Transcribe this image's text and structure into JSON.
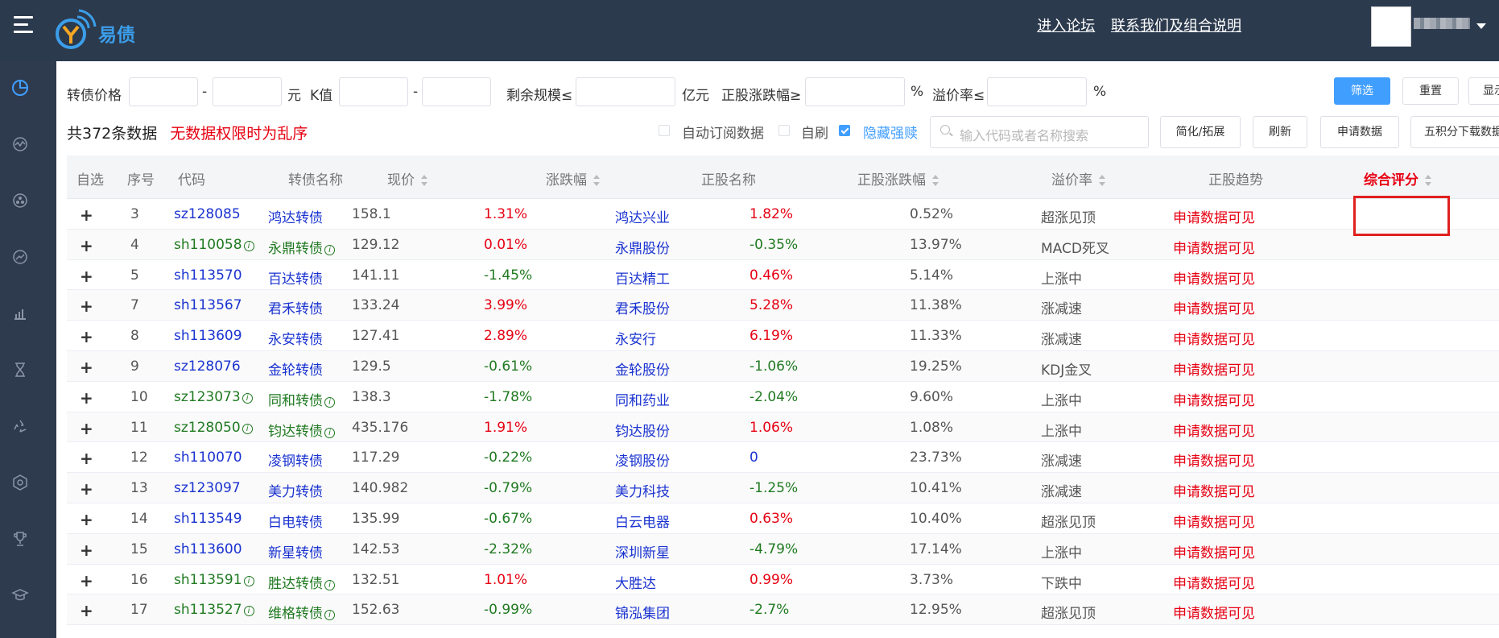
{
  "header": {
    "logo_text": "易债",
    "links": [
      "进入论坛",
      "联系我们及组合说明"
    ]
  },
  "filters": {
    "price_label": "转债价格",
    "dash": "-",
    "yuan": "元",
    "k_label": "K值",
    "scale_label": "剩余规模≤",
    "yiyuan": "亿元",
    "stock_change_label": "正股涨跌幅≥",
    "pct": "%",
    "premium_label": "溢价率≤",
    "btn_filter": "筛选",
    "btn_reset": "重置",
    "btn_display": "显示"
  },
  "summary": {
    "count_text": "共372条数据",
    "warning": "无数据权限时为乱序"
  },
  "options": {
    "auto_sub": "自动订阅数据",
    "self_refresh": "自刷",
    "hide_forced": "隐藏强赎",
    "search_placeholder": "输入代码或者名称搜索",
    "btn_simplify": "简化/拓展",
    "btn_refresh": "刷新",
    "btn_apply": "申请数据",
    "btn_download": "五积分下载数据"
  },
  "table": {
    "headers": [
      "自选",
      "序号",
      "代码",
      "转债名称",
      "现价",
      "涨跌幅",
      "正股名称",
      "正股涨跌幅",
      "溢价率",
      "正股趋势",
      "综合评分"
    ],
    "rows": [
      {
        "no": "3",
        "code": "sz128085",
        "name": "鸿达转债",
        "price": "158.1",
        "chg": "1.31%",
        "stock": "鸿达兴业",
        "schg": "1.82%",
        "premium": "0.52%",
        "trend": "超涨见顶",
        "score": "申请数据可见",
        "flag": false,
        "chg_up": true,
        "schg_up": true
      },
      {
        "no": "4",
        "code": "sh110058",
        "name": "永鼎转债",
        "price": "129.12",
        "chg": "0.01%",
        "stock": "永鼎股份",
        "schg": "-0.35%",
        "premium": "13.97%",
        "trend": "MACD死叉",
        "score": "申请数据可见",
        "flag": true,
        "chg_up": true,
        "schg_up": false
      },
      {
        "no": "5",
        "code": "sh113570",
        "name": "百达转债",
        "price": "141.11",
        "chg": "-1.45%",
        "stock": "百达精工",
        "schg": "0.46%",
        "premium": "5.14%",
        "trend": "上涨中",
        "score": "申请数据可见",
        "flag": false,
        "chg_up": false,
        "schg_up": true
      },
      {
        "no": "7",
        "code": "sh113567",
        "name": "君禾转债",
        "price": "133.24",
        "chg": "3.99%",
        "stock": "君禾股份",
        "schg": "5.28%",
        "premium": "11.38%",
        "trend": "涨减速",
        "score": "申请数据可见",
        "flag": false,
        "chg_up": true,
        "schg_up": true
      },
      {
        "no": "8",
        "code": "sh113609",
        "name": "永安转债",
        "price": "127.41",
        "chg": "2.89%",
        "stock": "永安行",
        "schg": "6.19%",
        "premium": "11.33%",
        "trend": "涨减速",
        "score": "申请数据可见",
        "flag": false,
        "chg_up": true,
        "schg_up": true
      },
      {
        "no": "9",
        "code": "sz128076",
        "name": "金轮转债",
        "price": "129.5",
        "chg": "-0.61%",
        "stock": "金轮股份",
        "schg": "-1.06%",
        "premium": "19.25%",
        "trend": "KDJ金叉",
        "score": "申请数据可见",
        "flag": false,
        "chg_up": false,
        "schg_up": false
      },
      {
        "no": "10",
        "code": "sz123073",
        "name": "同和转债",
        "price": "138.3",
        "chg": "-1.78%",
        "stock": "同和药业",
        "schg": "-2.04%",
        "premium": "9.60%",
        "trend": "上涨中",
        "score": "申请数据可见",
        "flag": true,
        "chg_up": false,
        "schg_up": false
      },
      {
        "no": "11",
        "code": "sz128050",
        "name": "钧达转债",
        "price": "435.176",
        "chg": "1.91%",
        "stock": "钧达股份",
        "schg": "1.06%",
        "premium": "1.08%",
        "trend": "上涨中",
        "score": "申请数据可见",
        "flag": true,
        "chg_up": true,
        "schg_up": true
      },
      {
        "no": "12",
        "code": "sh110070",
        "name": "凌钢转债",
        "price": "117.29",
        "chg": "-0.22%",
        "stock": "凌钢股份",
        "schg": "0",
        "premium": "23.73%",
        "trend": "涨减速",
        "score": "申请数据可见",
        "flag": false,
        "chg_up": false,
        "schg_up": null
      },
      {
        "no": "13",
        "code": "sz123097",
        "name": "美力转债",
        "price": "140.982",
        "chg": "-0.79%",
        "stock": "美力科技",
        "schg": "-1.25%",
        "premium": "10.41%",
        "trend": "涨减速",
        "score": "申请数据可见",
        "flag": false,
        "chg_up": false,
        "schg_up": false
      },
      {
        "no": "14",
        "code": "sh113549",
        "name": "白电转债",
        "price": "135.99",
        "chg": "-0.67%",
        "stock": "白云电器",
        "schg": "0.63%",
        "premium": "10.40%",
        "trend": "超涨见顶",
        "score": "申请数据可见",
        "flag": false,
        "chg_up": false,
        "schg_up": true
      },
      {
        "no": "15",
        "code": "sh113600",
        "name": "新星转债",
        "price": "142.53",
        "chg": "-2.32%",
        "stock": "深圳新星",
        "schg": "-4.79%",
        "premium": "17.14%",
        "trend": "上涨中",
        "score": "申请数据可见",
        "flag": false,
        "chg_up": false,
        "schg_up": false
      },
      {
        "no": "16",
        "code": "sh113591",
        "name": "胜达转债",
        "price": "132.51",
        "chg": "1.01%",
        "stock": "大胜达",
        "schg": "0.99%",
        "premium": "3.73%",
        "trend": "下跌中",
        "score": "申请数据可见",
        "flag": true,
        "chg_up": true,
        "schg_up": true
      },
      {
        "no": "17",
        "code": "sh113527",
        "name": "维格转债",
        "price": "152.63",
        "chg": "-0.99%",
        "stock": "锦泓集团",
        "schg": "-2.7%",
        "premium": "12.95%",
        "trend": "超涨见顶",
        "score": "申请数据可见",
        "flag": true,
        "chg_up": false,
        "schg_up": false
      }
    ]
  },
  "colors": {
    "up": "#e60012",
    "down": "#207a21",
    "link": "#1a33d0",
    "primary": "#409eff",
    "sidebar": "#2e3b4e"
  },
  "sidebar_icons": [
    "dashboard-icon",
    "wave-chart-icon",
    "radar-icon",
    "trend-icon",
    "bar-chart-icon",
    "hourglass-icon",
    "recycle-icon",
    "hexagon-icon",
    "trophy-icon",
    "graduation-cap-icon"
  ]
}
